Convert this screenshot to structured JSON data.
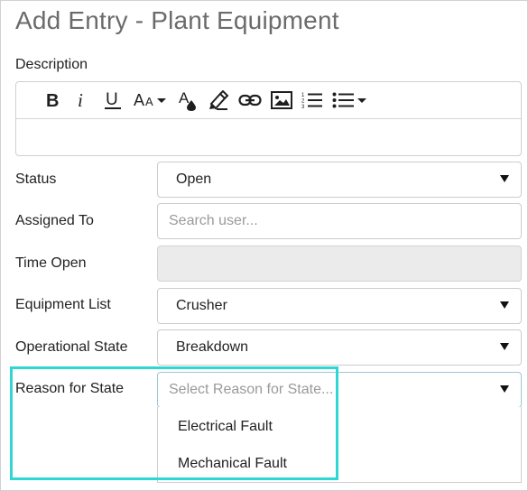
{
  "page": {
    "title": "Add Entry - Plant Equipment"
  },
  "description": {
    "label": "Description",
    "toolbar": {
      "bold_icon": "bold-icon",
      "italic_icon": "italic-icon",
      "underline_icon": "underline-icon",
      "font_size_icon": "font-size-icon",
      "text_color_icon": "text-color-icon",
      "highlight_icon": "highlighter-icon",
      "link_icon": "link-icon",
      "image_icon": "image-icon",
      "ordered_list_icon": "ordered-list-icon",
      "unordered_list_icon": "unordered-list-icon"
    },
    "value": ""
  },
  "status": {
    "label": "Status",
    "value": "Open"
  },
  "assigned_to": {
    "label": "Assigned To",
    "placeholder": "Search user..."
  },
  "time_open": {
    "label": "Time Open",
    "value": ""
  },
  "equipment_list": {
    "label": "Equipment List",
    "value": "Crusher"
  },
  "operational_state": {
    "label": "Operational State",
    "value": "Breakdown"
  },
  "reason_for_state": {
    "label": "Reason for State",
    "placeholder": "Select Reason for State...",
    "options": [
      "Electrical Fault",
      "Mechanical Fault"
    ]
  },
  "colors": {
    "highlight_border": "#2fd7d2",
    "disabled_background": "#ebebeb",
    "title": "#6b6b6b"
  }
}
